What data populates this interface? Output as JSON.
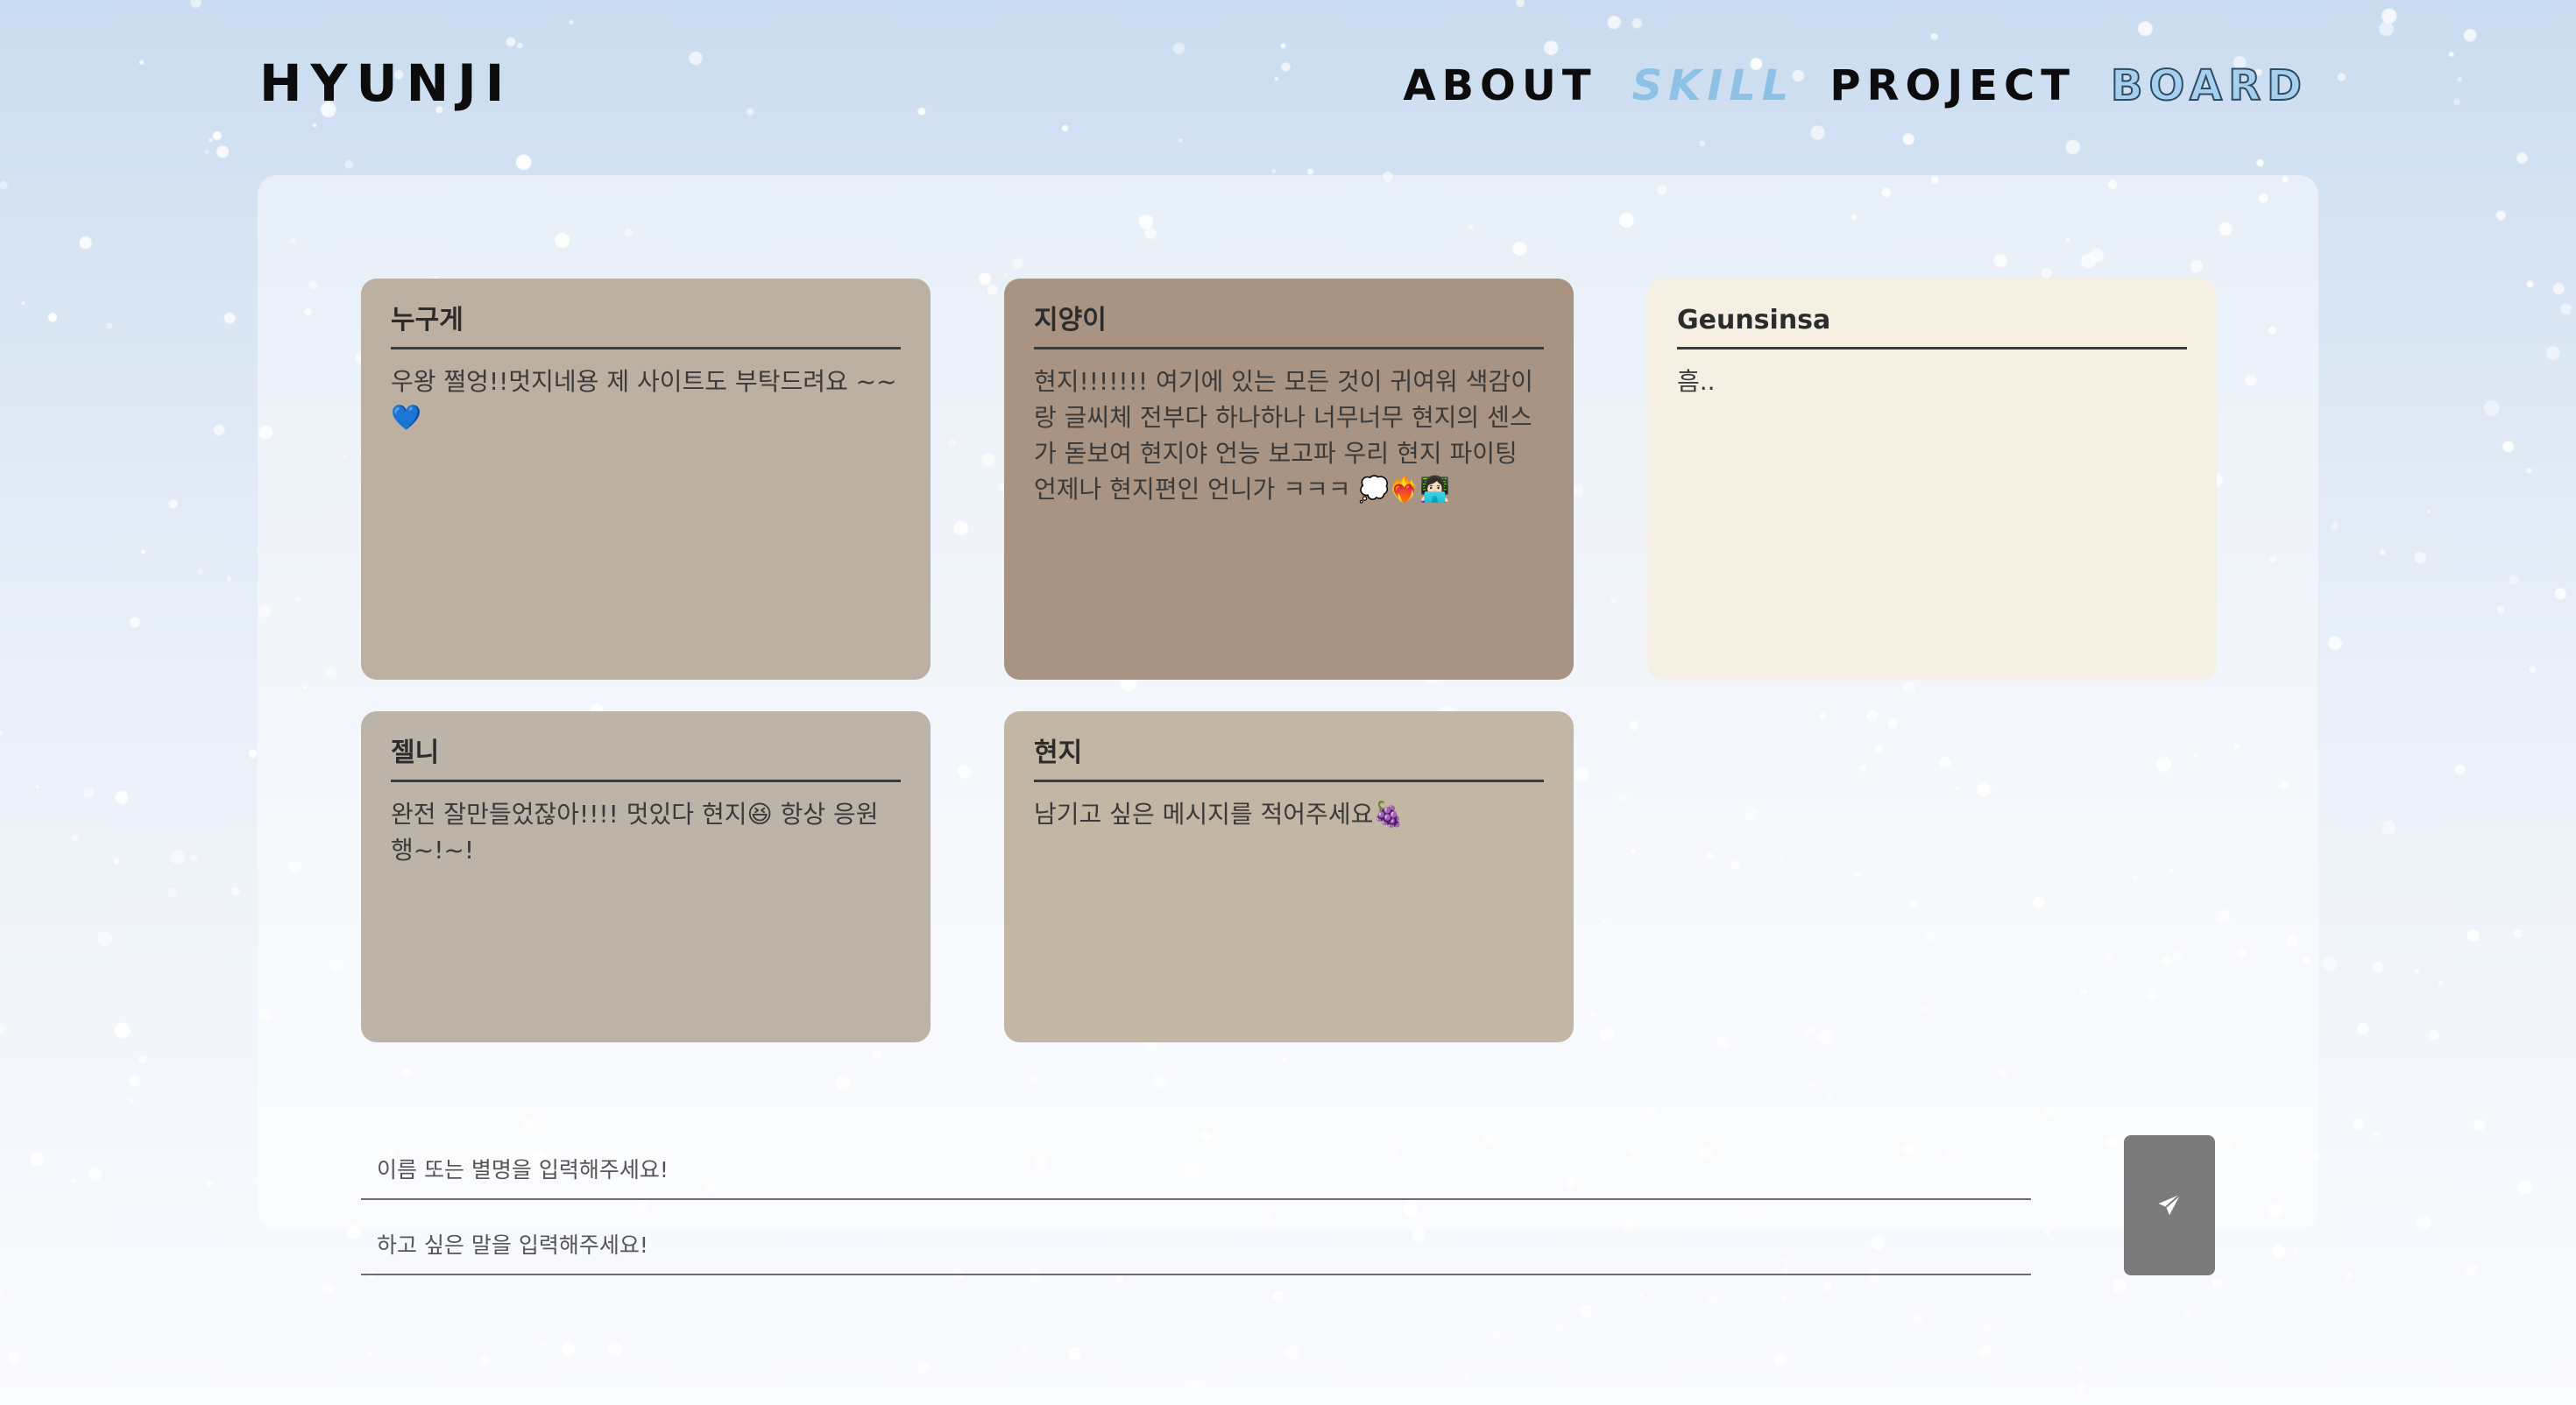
{
  "header": {
    "logo": "HYUNJI",
    "nav": [
      {
        "label": "ABOUT",
        "style": "plain"
      },
      {
        "label": "SKILL",
        "style": "italic"
      },
      {
        "label": "PROJECT",
        "style": "plain"
      },
      {
        "label": "BOARD",
        "style": "outline"
      }
    ]
  },
  "board": {
    "cards": [
      {
        "name": "누구게",
        "message": "우왕 쩔엉!!멋지네용 제 사이트도 부탁드려요 ~~",
        "emoji": "💙",
        "color": "#bcb0a2"
      },
      {
        "name": "지양이",
        "message": "현지!!!!!!! 여기에 있는 모든 것이 귀여워 색감이랑 글씨체 전부다 하나하나 너무너무 현지의 센스가 돋보여 현지야 언능 보고파 우리 현지 파이팅 언제나 현지편인 언니가 ㅋㅋㅋ",
        "emoji": "💭❤️‍🔥👩🏻‍💻",
        "color": "#a99483"
      },
      {
        "name": "Geunsinsa",
        "message": "흠..",
        "emoji": "",
        "color": "#f5f0e3"
      },
      {
        "name": "젤니",
        "message": "완전 잘만들었잖아!!!! 멋있다 현지😆 항상 응원행~!~!",
        "emoji": "",
        "color": "#bcb3a9"
      },
      {
        "name": "현지",
        "message": "남기고 싶은 메시지를 적어주세요",
        "emoji": "🍇",
        "color": "#c2b6a5"
      }
    ]
  },
  "form": {
    "name_placeholder": "이름 또는 별명을 입력해주세요!",
    "message_placeholder": "하고 싶은 말을 입력해주세요!",
    "name_value": "",
    "message_value": "",
    "send_icon": "paper-plane-icon"
  }
}
